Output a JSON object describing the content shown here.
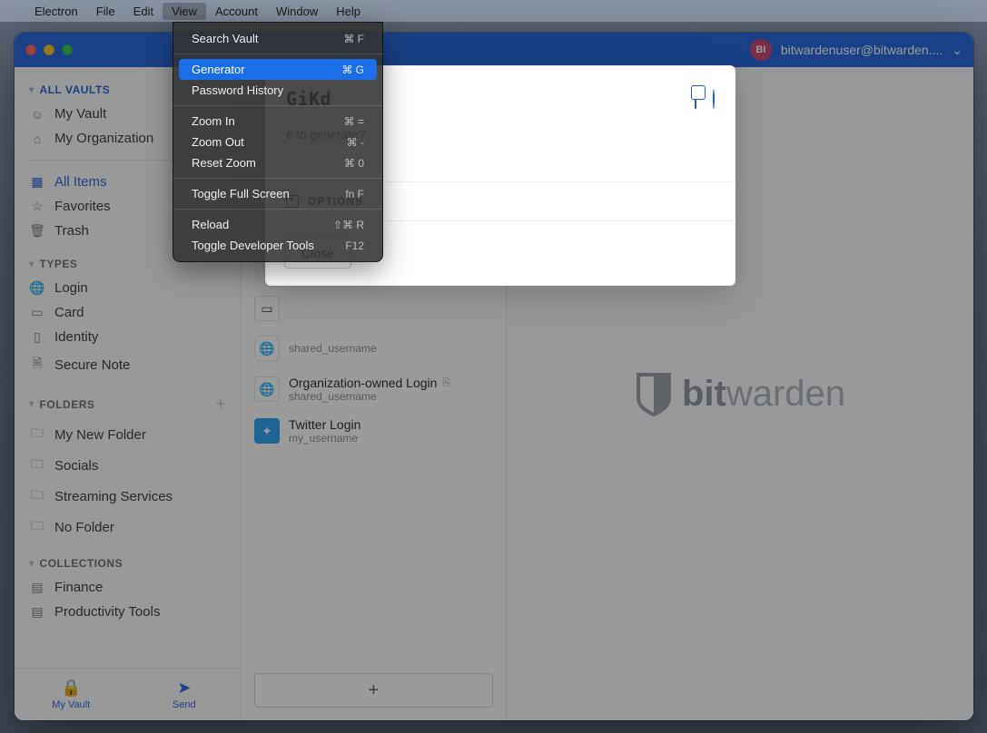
{
  "menubar": {
    "items": [
      "Electron",
      "File",
      "Edit",
      "View",
      "Account",
      "Window",
      "Help"
    ],
    "open_index": 3
  },
  "dropdown": {
    "groups": [
      [
        {
          "label": "Search Vault",
          "shortcut": "⌘ F"
        }
      ],
      [
        {
          "label": "Generator",
          "shortcut": "⌘ G",
          "selected": true
        },
        {
          "label": "Password History",
          "shortcut": ""
        }
      ],
      [
        {
          "label": "Zoom In",
          "shortcut": "⌘ ="
        },
        {
          "label": "Zoom Out",
          "shortcut": "⌘ -"
        },
        {
          "label": "Reset Zoom",
          "shortcut": "⌘ 0"
        }
      ],
      [
        {
          "label": "Toggle Full Screen",
          "shortcut": "fn F"
        }
      ],
      [
        {
          "label": "Reload",
          "shortcut": "⇧⌘ R"
        },
        {
          "label": "Toggle Developer Tools",
          "shortcut": "F12"
        }
      ]
    ]
  },
  "titlebar": {
    "traffic_colors": [
      "#ff5f57",
      "#febc2e",
      "#28c840"
    ],
    "avatar_initials": "BI",
    "account_email": "bitwardenuser@bitwarden....",
    "chevron": "⌄"
  },
  "sidebar": {
    "vaults_header": "ALL VAULTS",
    "vaults": [
      {
        "icon": "👤",
        "label": "My Vault"
      },
      {
        "icon": "🏢",
        "label": "My Organization"
      }
    ],
    "all_items": "All Items",
    "favorites": "Favorites",
    "trash": "Trash",
    "types_header": "TYPES",
    "types": [
      {
        "icon": "🌐",
        "label": "Login"
      },
      {
        "icon": "💳",
        "label": "Card"
      },
      {
        "icon": "🪪",
        "label": "Identity"
      },
      {
        "icon": "🗒",
        "label": "Secure Note"
      }
    ],
    "folders_header": "FOLDERS",
    "folders": [
      {
        "label": "My New Folder"
      },
      {
        "label": "Socials"
      },
      {
        "label": "Streaming Services"
      },
      {
        "label": "No Folder"
      }
    ],
    "collections_header": "COLLECTIONS",
    "collections": [
      {
        "label": "Finance"
      },
      {
        "label": "Productivity Tools"
      }
    ],
    "footer": {
      "my_vault": "My Vault",
      "send": "Send"
    }
  },
  "list": {
    "items": [
      {
        "icon_type": "card",
        "title": "",
        "sub": ""
      },
      {
        "icon_type": "globe",
        "title": "",
        "sub": "shared_username"
      },
      {
        "icon_type": "globe",
        "title": "Organization-owned Login",
        "sub": "shared_username",
        "shared": true
      },
      {
        "icon_type": "tw",
        "title": "Twitter Login",
        "sub": "my_username"
      }
    ]
  },
  "generator": {
    "password_display": "GiKd",
    "question": "e to generate?",
    "options_label": "OPTIONS",
    "close_label": "Close"
  },
  "brand": {
    "bold": "bit",
    "rest": "warden"
  }
}
